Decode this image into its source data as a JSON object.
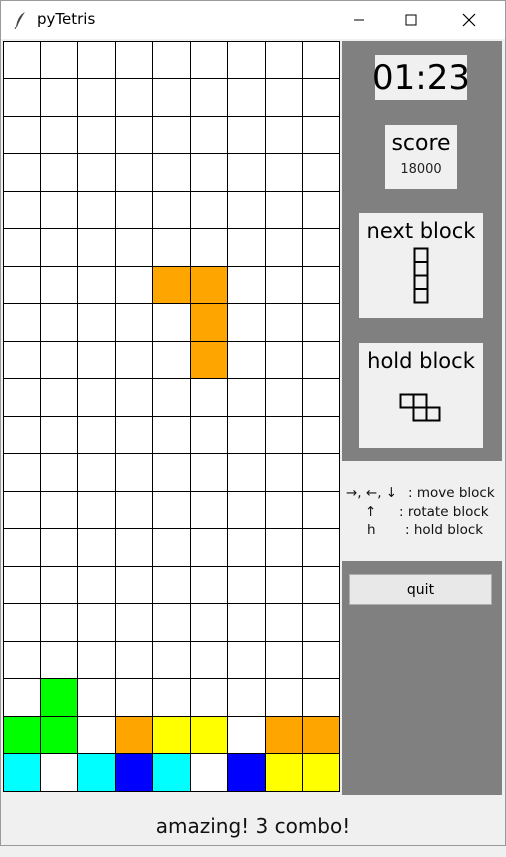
{
  "window": {
    "title": "pyTetris",
    "icon": "feather-icon",
    "controls": [
      "minimize-icon",
      "maximize-icon",
      "close-icon"
    ]
  },
  "board": {
    "columns": 9,
    "rows": 20,
    "grid_color": "#000000",
    "empty_color": "#ffffff",
    "filled_cells": [
      {
        "row": 6,
        "col": 4,
        "color": "#ffa500"
      },
      {
        "row": 6,
        "col": 5,
        "color": "#ffa500"
      },
      {
        "row": 7,
        "col": 5,
        "color": "#ffa500"
      },
      {
        "row": 8,
        "col": 5,
        "color": "#ffa500"
      },
      {
        "row": 17,
        "col": 1,
        "color": "#00ff00"
      },
      {
        "row": 18,
        "col": 0,
        "color": "#00ff00"
      },
      {
        "row": 18,
        "col": 1,
        "color": "#00ff00"
      },
      {
        "row": 18,
        "col": 3,
        "color": "#ffa500"
      },
      {
        "row": 18,
        "col": 4,
        "color": "#ffff00"
      },
      {
        "row": 18,
        "col": 5,
        "color": "#ffff00"
      },
      {
        "row": 18,
        "col": 7,
        "color": "#ffa500"
      },
      {
        "row": 18,
        "col": 8,
        "color": "#ffa500"
      },
      {
        "row": 19,
        "col": 0,
        "color": "#00ffff"
      },
      {
        "row": 19,
        "col": 2,
        "color": "#00ffff"
      },
      {
        "row": 19,
        "col": 3,
        "color": "#0000ff"
      },
      {
        "row": 19,
        "col": 4,
        "color": "#00ffff"
      },
      {
        "row": 19,
        "col": 6,
        "color": "#0000ff"
      },
      {
        "row": 19,
        "col": 7,
        "color": "#ffff00"
      },
      {
        "row": 19,
        "col": 8,
        "color": "#ffff00"
      }
    ]
  },
  "side": {
    "timer": "01:23",
    "score_label": "score",
    "score_value": "18000",
    "next_label": "next block",
    "next_piece_icon": "i-block-icon",
    "hold_label": "hold block",
    "hold_piece_icon": "s-block-icon",
    "help": {
      "move_keys": "→, ←, ↓",
      "move_desc": ": move block",
      "rotate_key": "↑",
      "rotate_desc": ": rotate block",
      "hold_key": "h",
      "hold_desc": ": hold block"
    },
    "quit_label": "quit",
    "panel_color": "#808080"
  },
  "status": {
    "message": "amazing! 3 combo!"
  }
}
